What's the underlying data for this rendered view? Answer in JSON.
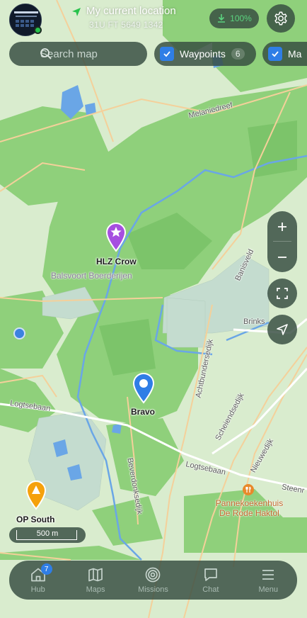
{
  "header": {
    "location_title": "My current location",
    "location_coords": "31U FT 5649 1342",
    "download_label": "100%",
    "settings_icon": "gear-icon"
  },
  "search": {
    "placeholder": "Search map"
  },
  "filters": [
    {
      "label": "Waypoints",
      "count": "6",
      "checked": true
    },
    {
      "label": "Ma",
      "checked": true
    }
  ],
  "map": {
    "waypoints": [
      {
        "name": "HLZ Crow",
        "color": "#a64fe0",
        "icon": "star-icon"
      },
      {
        "name": "Bravo",
        "color": "#2f7ee6",
        "icon": "dot-icon"
      },
      {
        "name": "OP South",
        "color": "#f5a10c",
        "icon": "triangle-icon"
      }
    ],
    "roads": [
      "Melaniedreef",
      "Banisveld",
      "Brinks",
      "Achtbundersedijk",
      "Logtsebaan",
      "Logtsebaan",
      "Scheiendsedijk",
      "Nieuwedijk",
      "Steenr",
      "Beverdonksedijk"
    ],
    "place": "Balsvoort Boerderijen",
    "poi": {
      "name": "Pannekoekenhuis\nDe Rode Haktol",
      "color": "#e8892b"
    },
    "scale": "500 m"
  },
  "nav": {
    "items": [
      {
        "label": "Hub",
        "icon": "home-icon",
        "badge": "7"
      },
      {
        "label": "Maps",
        "icon": "map-icon"
      },
      {
        "label": "Missions",
        "icon": "target-icon"
      },
      {
        "label": "Chat",
        "icon": "chat-icon"
      },
      {
        "label": "Menu",
        "icon": "menu-icon"
      }
    ]
  },
  "colors": {
    "forest": "#8fd07b",
    "open_land": "#d9ecce",
    "water": "#6aa6e6",
    "heath": "#c4dccf",
    "panel": "#344a40",
    "accent": "#2f7ee6"
  }
}
